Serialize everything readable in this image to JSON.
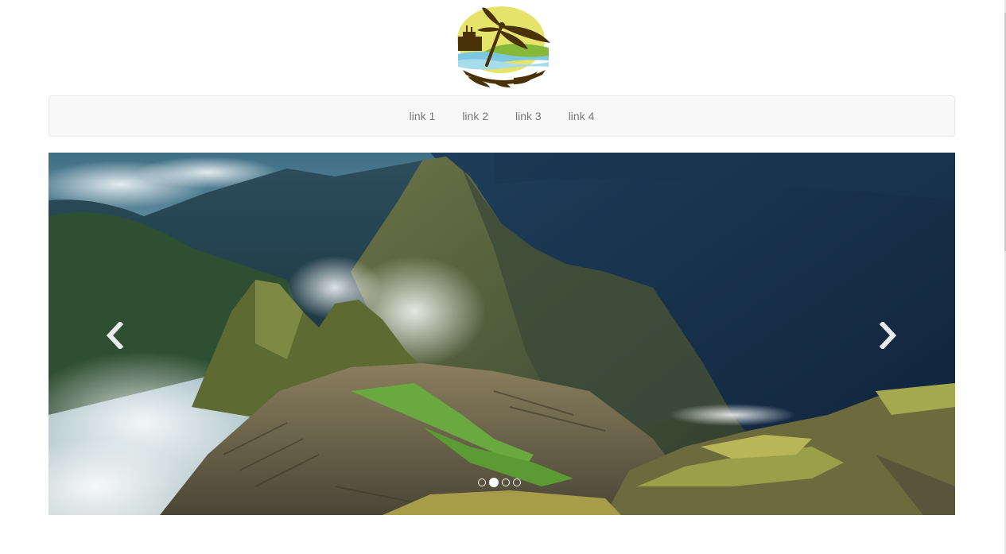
{
  "logo": {
    "icon": "dragonfly-logo-icon",
    "colors": {
      "dragonfly": "#4a3208",
      "sun": "#e6e36a",
      "hill": "#86b83a",
      "water": "#7cc8e0",
      "base": "#4a3208"
    }
  },
  "nav": {
    "links": [
      {
        "label": "link 1"
      },
      {
        "label": "link 2"
      },
      {
        "label": "link 3"
      },
      {
        "label": "link 4"
      }
    ]
  },
  "carousel": {
    "image": "machu-picchu-mountain-landscape",
    "prev_icon": "chevron-left-icon",
    "next_icon": "chevron-right-icon",
    "slide_count": 4,
    "active_index": 1
  }
}
